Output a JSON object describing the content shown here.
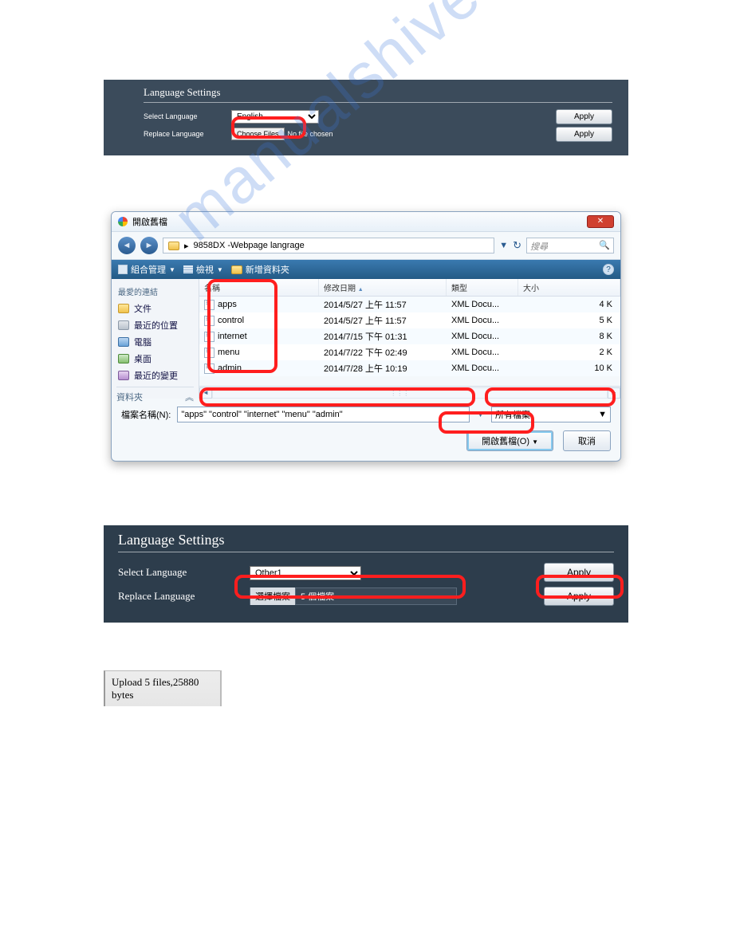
{
  "panel1": {
    "title": "Language Settings",
    "select_label": "Select Language",
    "replace_label": "Replace Language",
    "lang_value": "English",
    "choose_btn": "Choose Files",
    "no_file": "No file chosen",
    "apply": "Apply"
  },
  "dialog": {
    "title": "開啟舊檔",
    "path": "9858DX -Webpage langrage",
    "search_placeholder": "搜尋",
    "toolbar": {
      "organize": "組合管理",
      "view": "檢視",
      "newfolder": "新增資料夾"
    },
    "sidebar": {
      "fav": "最愛的連結",
      "items": [
        "文件",
        "最近的位置",
        "電腦",
        "桌面",
        "最近的變更"
      ],
      "folders": "資料夾"
    },
    "columns": {
      "name": "名稱",
      "date": "修改日期",
      "type": "類型",
      "size": "大小"
    },
    "rows": [
      {
        "name": "apps",
        "date": "2014/5/27 上午 11:57",
        "type": "XML Docu...",
        "size": "4 K"
      },
      {
        "name": "control",
        "date": "2014/5/27 上午 11:57",
        "type": "XML Docu...",
        "size": "5 K"
      },
      {
        "name": "internet",
        "date": "2014/7/15 下午 01:31",
        "type": "XML Docu...",
        "size": "8 K"
      },
      {
        "name": "menu",
        "date": "2014/7/22 下午 02:49",
        "type": "XML Docu...",
        "size": "2 K"
      },
      {
        "name": "admin",
        "date": "2014/7/28 上午 10:19",
        "type": "XML Docu...",
        "size": "10 K"
      }
    ],
    "filename_label": "檔案名稱(N):",
    "filename_value": "\"apps\" \"control\" \"internet\" \"menu\" \"admin\"",
    "filetype": "所有檔案",
    "open_btn": "開啟舊檔(O)",
    "cancel_btn": "取消"
  },
  "panel3": {
    "title": "Language Settings",
    "select_label": "Select Language",
    "replace_label": "Replace Language",
    "lang_value": "Other1",
    "pick_btn": "選擇檔案",
    "pick_value": "5 個檔案",
    "apply": "Apply"
  },
  "panel4": {
    "text": "Upload 5 files,25880 bytes"
  },
  "watermark": "manualshive.com"
}
